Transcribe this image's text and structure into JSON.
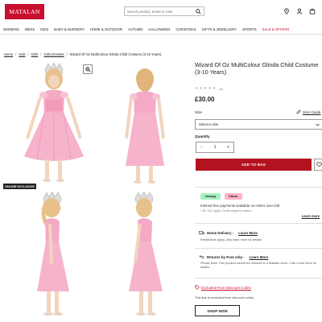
{
  "header": {
    "logo": "MATALAN",
    "search_placeholder": "Search product, brand or code"
  },
  "nav": {
    "items": [
      "WOMENS",
      "MENS",
      "KIDS",
      "BABY & NURSERY",
      "HOME & OUTDOOR",
      "AUTUMN",
      "HALLOWEEN",
      "CHRISTMAS",
      "GIFTS & JEWELLERY",
      "SPORTS"
    ],
    "sale": "SALE & OFFERS"
  },
  "breadcrumb": {
    "items": [
      "Home",
      "Kids",
      "Girls",
      "Girls Dresses"
    ],
    "current": "Wizard Of Oz MultiColour Glinda Child Costume (3-10 Years)"
  },
  "gallery": {
    "badge": "ONLINE EXCLUSIVE"
  },
  "product": {
    "title": "Wizard Of Oz MultiColour Glinda Child Costume (3-10 Years)",
    "rating": 0,
    "review_count": "(0)",
    "price": "£30.00",
    "size_label": "Size",
    "size_guide": "Size Guide",
    "size_select": "Select a size",
    "quantity_label": "Quantity",
    "quantity": "1",
    "add_to_bag": "ADD TO BAG"
  },
  "payment": {
    "pill_a": "clearpay",
    "pill_b": "Klarna.",
    "line1": "Interest-free payments available on orders over £30",
    "line2": "+18, T&C apply. Credit subject to status.",
    "learn_more": "Learn more"
  },
  "delivery": {
    "home_title": "Home Delivery -",
    "home_link": "Learn More",
    "home_sub": "Restrictions apply, click learn more for details",
    "returns_title": "Returns by Post only -",
    "returns_link": "Learn More",
    "returns_sub": "Please Note: This product cannot be returned to a Matalan store. Click Learn More for details."
  },
  "discount": {
    "title": "Excluded From Discount Codes",
    "sub": "This line is excluded from discount codes.",
    "shop_now": "SHOP NOW"
  },
  "colors": {
    "brand_red": "#c8102e",
    "button_red": "#b3121f"
  }
}
